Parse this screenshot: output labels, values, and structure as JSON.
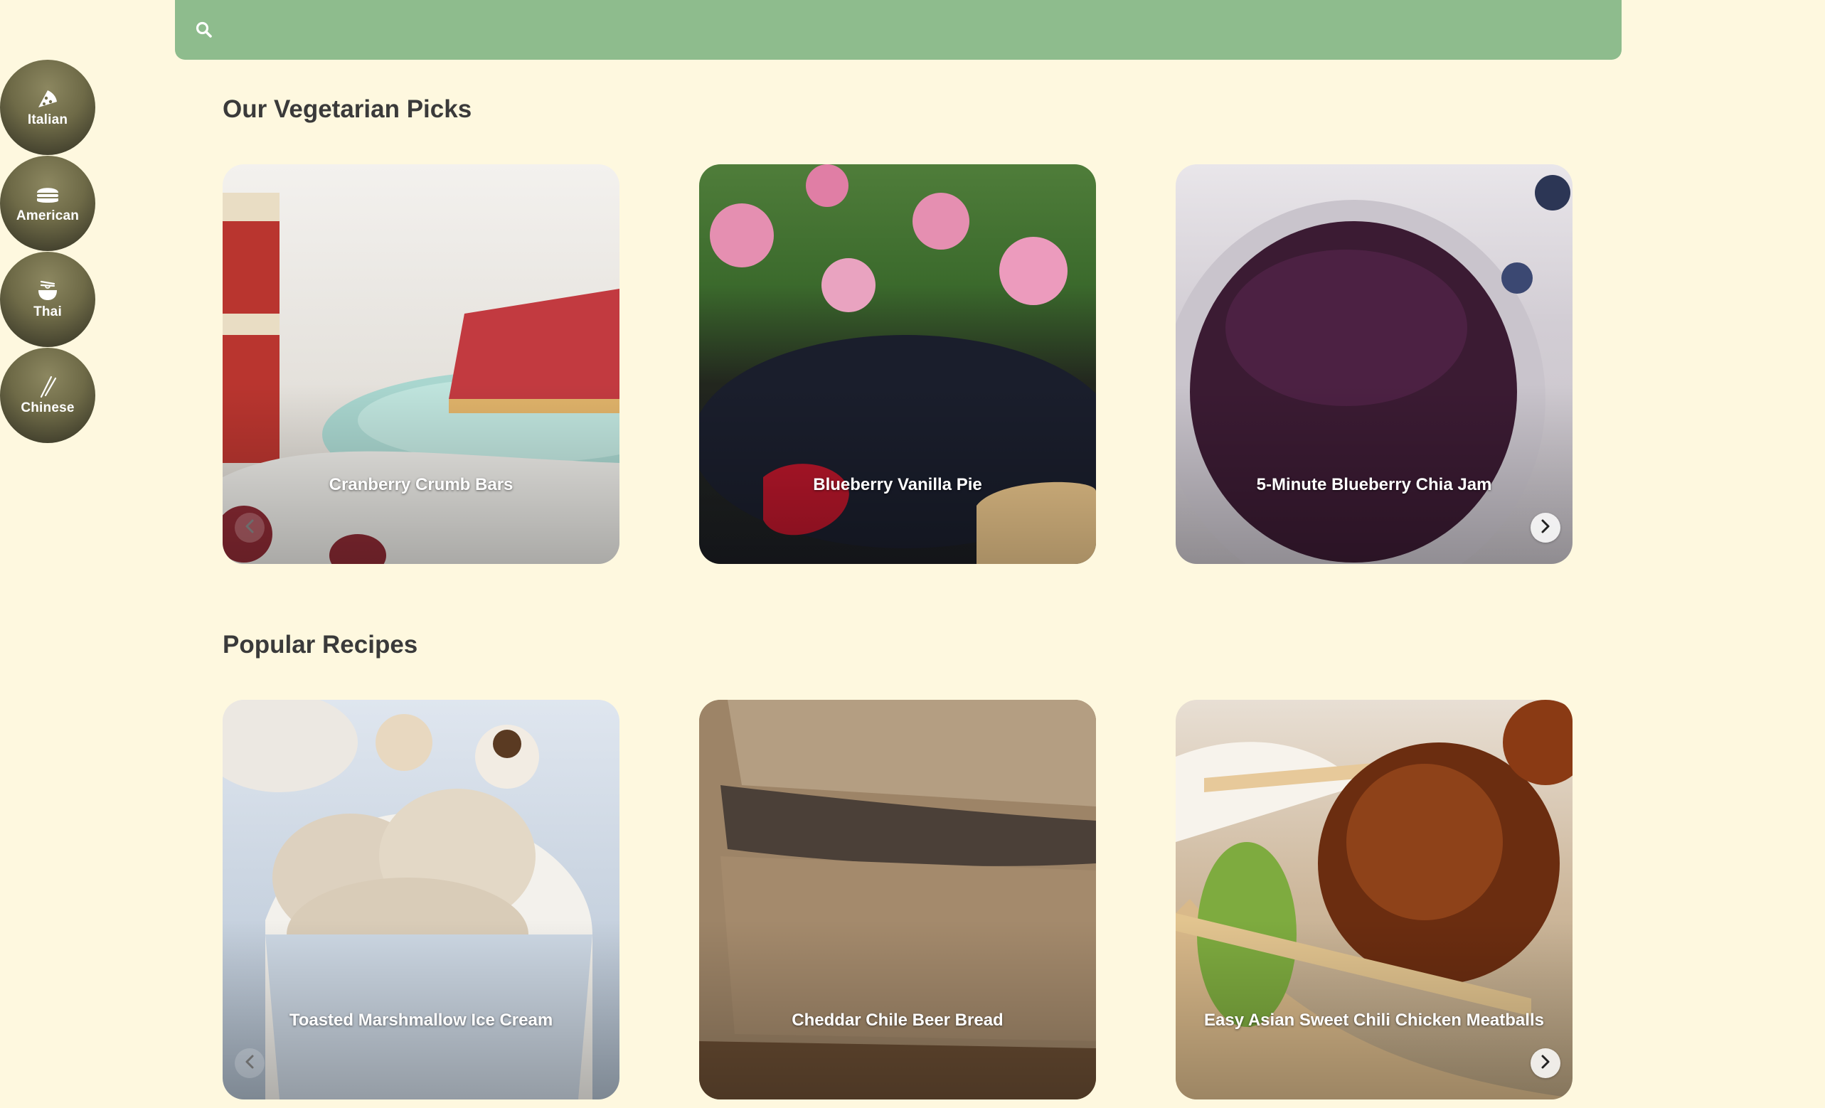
{
  "search": {
    "placeholder": "",
    "value": "",
    "icon": "search-icon"
  },
  "cuisines": [
    {
      "label": "Italian",
      "icon": "pizza-icon"
    },
    {
      "label": "American",
      "icon": "burger-icon"
    },
    {
      "label": "Thai",
      "icon": "noodle-bowl-icon"
    },
    {
      "label": "Chinese",
      "icon": "chopsticks-icon"
    }
  ],
  "sections": [
    {
      "title": "Our Vegetarian Picks",
      "cards": [
        {
          "title": "Cranberry Crumb Bars"
        },
        {
          "title": "Blueberry Vanilla Pie"
        },
        {
          "title": "5-Minute Blueberry Chia Jam"
        }
      ]
    },
    {
      "title": "Popular Recipes",
      "cards": [
        {
          "title": "Toasted Marshmallow Ice Cream"
        },
        {
          "title": "Cheddar Chile Beer Bread"
        },
        {
          "title": "Easy Asian Sweet Chili Chicken Meatballs"
        }
      ]
    }
  ],
  "colors": {
    "background": "#fef8df",
    "search_bar": "#8ebc8d",
    "cuisine_button": "#6e6a47",
    "heading_text": "#3a3a3a"
  }
}
